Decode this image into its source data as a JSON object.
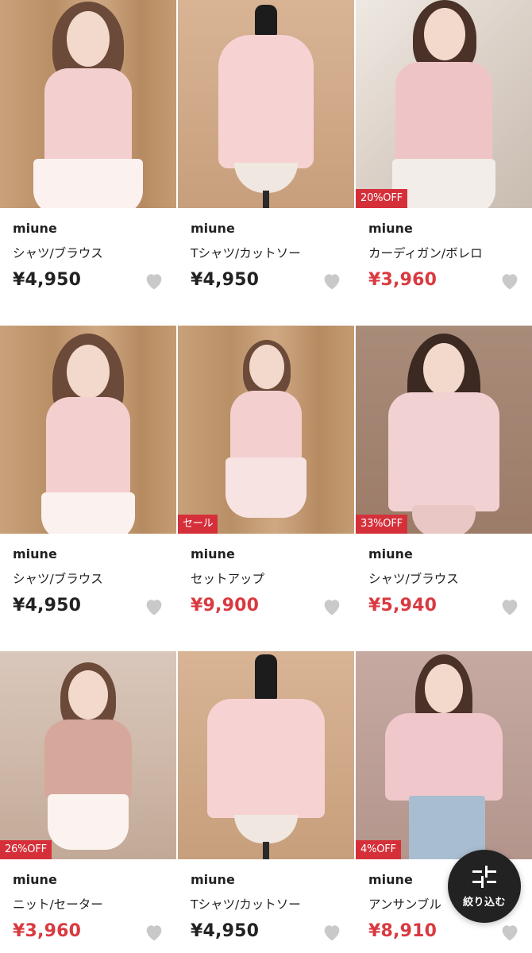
{
  "products": [
    {
      "brand": "miune",
      "category": "シャツ/ブラウス",
      "price": "¥4,950",
      "sale": false,
      "badge": ""
    },
    {
      "brand": "miune",
      "category": "Tシャツ/カットソー",
      "price": "¥4,950",
      "sale": false,
      "badge": ""
    },
    {
      "brand": "miune",
      "category": "カーディガン/ボレロ",
      "price": "¥3,960",
      "sale": true,
      "badge": "20%OFF"
    },
    {
      "brand": "miune",
      "category": "シャツ/ブラウス",
      "price": "¥4,950",
      "sale": false,
      "badge": ""
    },
    {
      "brand": "miune",
      "category": "セットアップ",
      "price": "¥9,900",
      "sale": true,
      "badge": "セール"
    },
    {
      "brand": "miune",
      "category": "シャツ/ブラウス",
      "price": "¥5,940",
      "sale": true,
      "badge": "33%OFF"
    },
    {
      "brand": "miune",
      "category": "ニット/セーター",
      "price": "¥3,960",
      "sale": true,
      "badge": "26%OFF"
    },
    {
      "brand": "miune",
      "category": "Tシャツ/カットソー",
      "price": "¥4,950",
      "sale": false,
      "badge": ""
    },
    {
      "brand": "miune",
      "category": "アンサンブル",
      "price": "¥8,910",
      "sale": true,
      "badge": "4%OFF"
    }
  ],
  "filter": {
    "label": "絞り込む",
    "icon": "filter-sliders-icon"
  },
  "colors": {
    "sale_price": "#d93a40",
    "badge_bg": "#d5303a",
    "heart": "#c9c9c9",
    "filter_bg": "#222222"
  }
}
